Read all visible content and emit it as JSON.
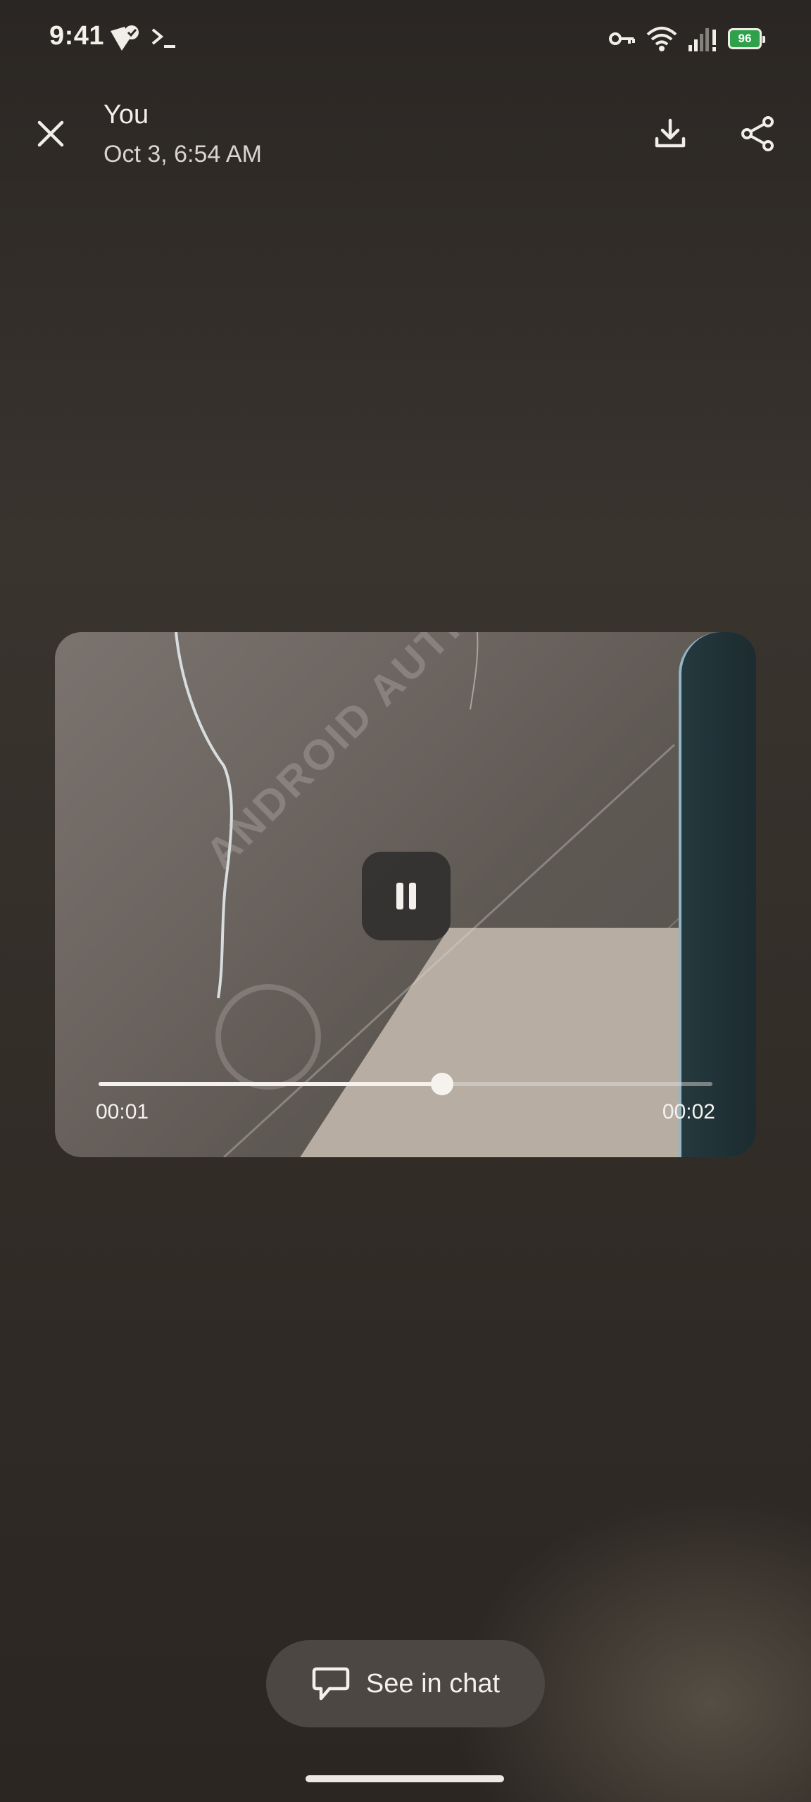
{
  "status_bar": {
    "time": "9:41",
    "battery_level": "96",
    "battery_color": "#2fa14a",
    "icons": [
      "maps-check-icon",
      "terminal-icon",
      "vpn-key-icon",
      "wifi-icon",
      "signal-icon",
      "battery-charging-icon"
    ]
  },
  "header": {
    "sender": "You",
    "timestamp": "Oct 3, 6:54 AM",
    "close_icon": "close-icon",
    "download_icon": "download-icon",
    "share_icon": "share-icon"
  },
  "video": {
    "watermark_text": "ANDROID AUTHORITY",
    "current_time": "00:01",
    "total_time": "00:02",
    "progress_fraction": 0.56,
    "state": "playing",
    "control_icon": "pause-icon"
  },
  "actions": {
    "see_in_chat_label": "See in chat",
    "see_in_chat_icon": "chat-bubble-icon"
  }
}
